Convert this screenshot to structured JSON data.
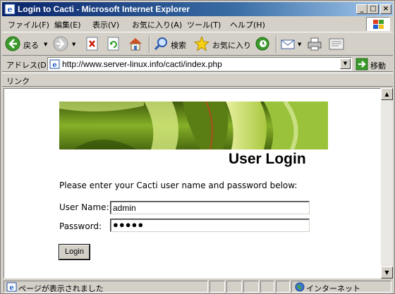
{
  "window": {
    "title": "Login to Cacti - Microsoft Internet Explorer",
    "caption_minimize": "_",
    "caption_maximize": "□",
    "caption_close": "×"
  },
  "menu": {
    "items": [
      {
        "label": "ファイル(F)"
      },
      {
        "label": "編集(E)"
      },
      {
        "label": "表示(V)"
      },
      {
        "label": "お気に入り(A)"
      },
      {
        "label": "ツール(T)"
      },
      {
        "label": "ヘルプ(H)"
      }
    ]
  },
  "toolbar": {
    "back_label": "戻る",
    "search_label": "検索",
    "favorites_label": "お気に入り",
    "dropdown_glyph": "▼"
  },
  "address": {
    "label": "アドレス(D)",
    "url": "http://www.server-linux.info/cacti/index.php",
    "go_label": "移動",
    "dropdown_glyph": "▼"
  },
  "links": {
    "label": "リンク"
  },
  "page": {
    "heading": "User Login",
    "prompt": "Please enter your Cacti user name and password below:",
    "username_label": "User Name:",
    "username_value": "admin",
    "password_label": "Password:",
    "password_value": "●●●●●",
    "login_button": "Login"
  },
  "scrollbar": {
    "up_glyph": "▲",
    "down_glyph": "▼"
  },
  "status": {
    "message": "ページが表示されました",
    "zone": "インターネット"
  },
  "colors": {
    "titlebar_start": "#0a246a",
    "titlebar_end": "#a6caf0",
    "chrome": "#d4d0c8",
    "banner_green": "#6f9a1e"
  }
}
